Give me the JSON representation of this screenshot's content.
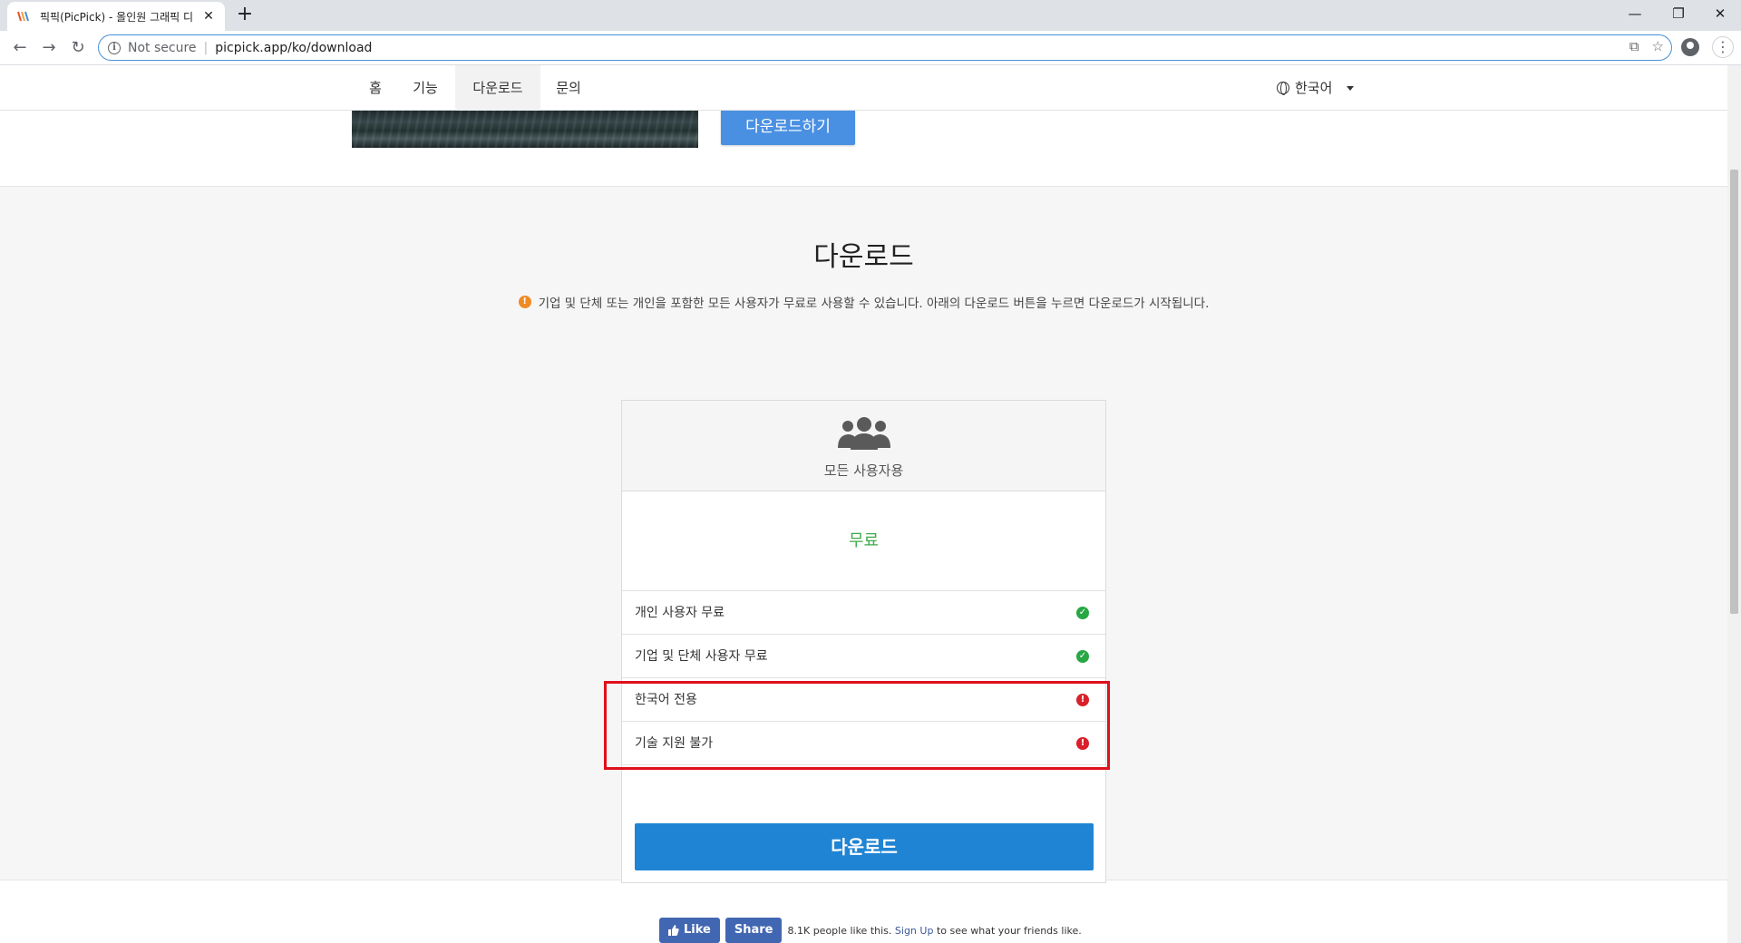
{
  "browser": {
    "tab_title": "픽픽(PicPick) - 올인원 그래픽 디",
    "tab_close": "✕",
    "new_tab": "+",
    "security_label": "Not secure",
    "url": "picpick.app/ko/download",
    "window_controls": {
      "minimize": "—",
      "restore": "❐",
      "close": "✕"
    },
    "nav": {
      "back": "←",
      "forward": "→",
      "reload": "↻"
    },
    "omni_icons": {
      "translate": "⧉",
      "bookmark": "☆"
    },
    "menu": "⋮"
  },
  "site_nav": {
    "items": [
      "홈",
      "기능",
      "다운로드",
      "문의"
    ],
    "active_index": 2,
    "language": "한국어"
  },
  "hero": {
    "download_button": "다운로드하기"
  },
  "download": {
    "title": "다운로드",
    "notice": "기업 및 단체 또는 개인을 포함한 모든 사용자가 무료로 사용할 수 있습니다. 아래의 다운로드 버튼을 누르면 다운로드가 시작됩니다.",
    "card": {
      "audience": "모든 사용자용",
      "price": "무료",
      "features": [
        {
          "label": "개인 사용자 무료",
          "status": "ok"
        },
        {
          "label": "기업 및 단체 사용자 무료",
          "status": "ok"
        },
        {
          "label": "한국어 전용",
          "status": "bad"
        },
        {
          "label": "기술 지원 불가",
          "status": "bad"
        }
      ],
      "button": "다운로드"
    }
  },
  "social": {
    "like": "Like",
    "share": "Share",
    "text_before": "8.1K people like this.",
    "sign_up": "Sign Up",
    "text_after": "to see what your friends like."
  },
  "colors": {
    "accent_blue": "#1f84d3",
    "price_green": "#3fa94a",
    "ok_green": "#28a745",
    "bad_red": "#d9202b",
    "highlight_red": "#e0101c",
    "facebook_blue": "#4267b2"
  }
}
